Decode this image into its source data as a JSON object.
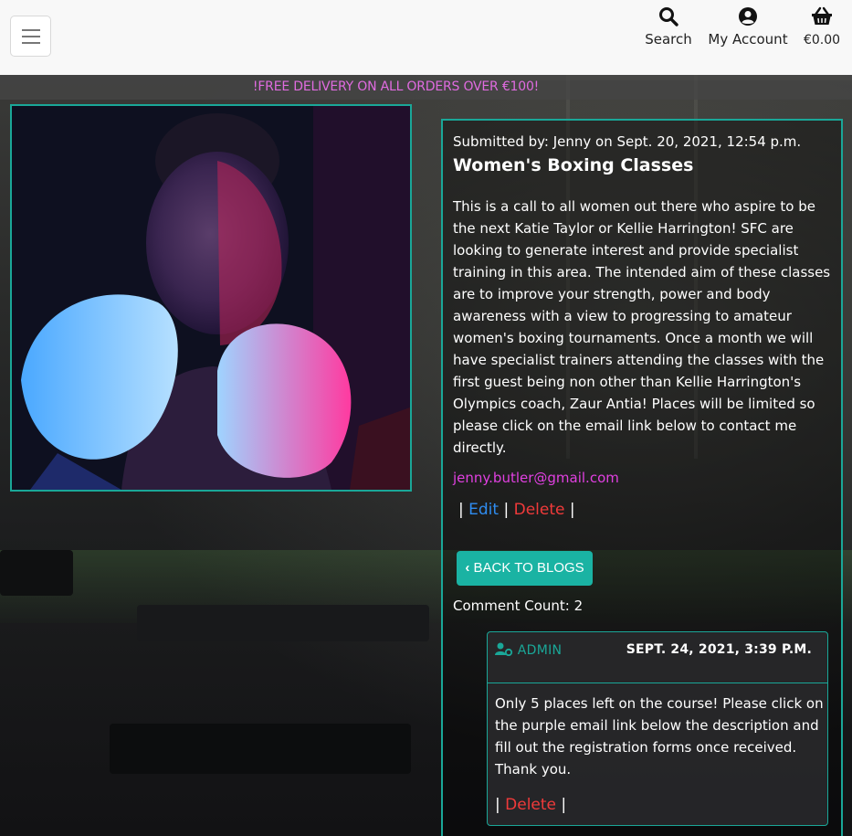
{
  "header": {
    "search_label": "Search",
    "account_label": "My Account",
    "basket_total": "€0.00",
    "icons": {
      "menu": "hamburger-icon",
      "search": "search-icon",
      "account": "user-circle-icon",
      "basket": "basket-icon"
    }
  },
  "promo": "!FREE DELIVERY ON ALL ORDERS OVER €100!",
  "post": {
    "meta": "Submitted by: Jenny on Sept. 20, 2021, 12:54 p.m.",
    "title": "Women's Boxing Classes",
    "body": "This is a call to all women out there who aspire to be the next Katie Taylor or Kellie Harrington! SFC are looking to generate interest and provide specialist training in this area. The intended aim of these classes are to improve your strength, power and body awareness with a view to progressing to amateur women's boxing tournaments. Once a month we will have specialist trainers attending the classes with the first guest being non other than Kellie Harrington's Olympics coach, Zaur Antia! Places will be limited so please click on the email link below to contact me directly.",
    "email": "jenny.butler@gmail.com",
    "edit_label": "Edit",
    "delete_label": "Delete",
    "back_label": "BACK TO BLOGS",
    "comment_count": "Comment Count: 2"
  },
  "comment": {
    "author": "ADMIN",
    "date": "SEPT. 24, 2021, 3:39 P.M.",
    "text": "Only 5 places left on the course! Please click on the purple email link below the description and fill out the registration forms once received. Thank you.",
    "delete_label": "Delete"
  },
  "colors": {
    "accent": "#1aa798",
    "email": "#e040e0",
    "edit": "#2f8cf0",
    "delete": "#f03a3a",
    "promo": "#e06be0"
  }
}
